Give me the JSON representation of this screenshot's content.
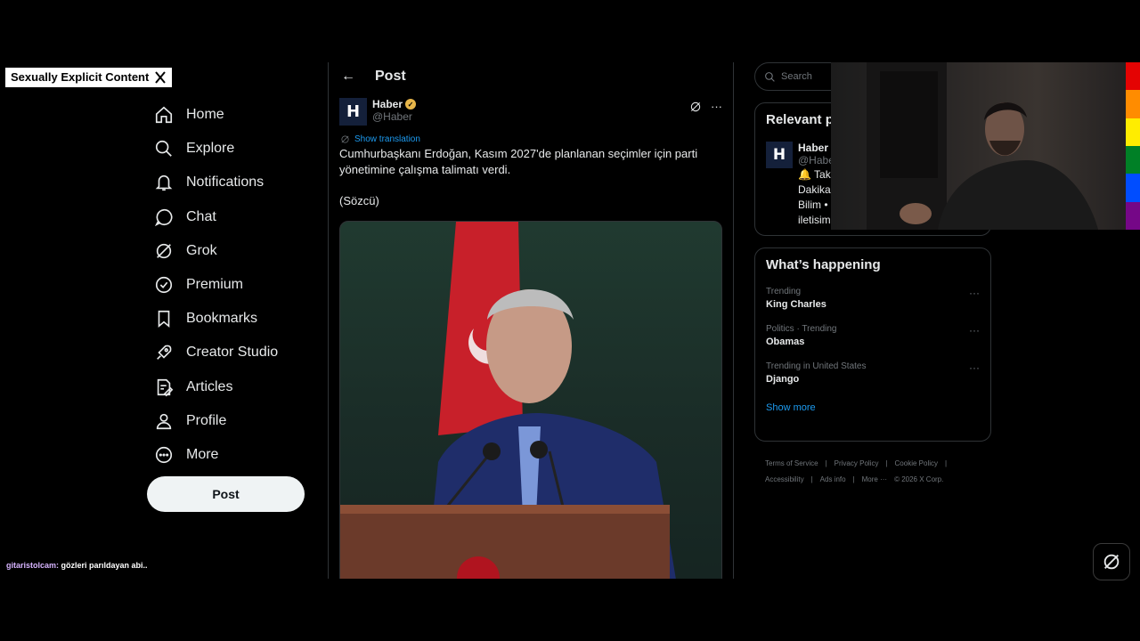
{
  "overlay": {
    "banner_text": "Sexually Explicit Content",
    "chat_user": "gitaristolcam:",
    "chat_message": " gözleri parıldayan abi.."
  },
  "nav": {
    "items": [
      {
        "label": "Home",
        "icon": "home-icon"
      },
      {
        "label": "Explore",
        "icon": "search-icon"
      },
      {
        "label": "Notifications",
        "icon": "bell-icon"
      },
      {
        "label": "Chat",
        "icon": "chat-icon"
      },
      {
        "label": "Grok",
        "icon": "grok-icon"
      },
      {
        "label": "Premium",
        "icon": "premium-icon"
      },
      {
        "label": "Bookmarks",
        "icon": "bookmark-icon"
      },
      {
        "label": "Creator Studio",
        "icon": "rocket-icon"
      },
      {
        "label": "Articles",
        "icon": "article-icon"
      },
      {
        "label": "Profile",
        "icon": "profile-icon"
      },
      {
        "label": "More",
        "icon": "more-circle-icon"
      }
    ],
    "post_button": "Post"
  },
  "center": {
    "back_arrow": "←",
    "title": "Post",
    "post": {
      "avatar_letter": "H",
      "author_name": "Haber",
      "author_handle": "@Haber",
      "more": "···",
      "show_translation": "Show translation",
      "text": "Cumhurbaşkanı Erdoğan, Kasım 2027'de planlanan seçimler için parti yönetimine çalışma talimatı verdi.",
      "source": "(Sözcü)"
    }
  },
  "right": {
    "search_placeholder": "Search",
    "relevant": {
      "title": "Relevant p",
      "user_name": "Haber",
      "user_handle": "@Habe",
      "bio_line1": "🔔 Tak",
      "bio_line2": "Dakika",
      "bio_line3": "Bilim • S",
      "bio_line4": "iletisim"
    },
    "happening": {
      "title": "What’s happening",
      "trends": [
        {
          "meta": "Trending",
          "topic": "King Charles"
        },
        {
          "meta": "Politics · Trending",
          "topic": "Obamas"
        },
        {
          "meta": "Trending in United States",
          "topic": "Django"
        }
      ],
      "show_more": "Show more"
    },
    "footer": {
      "links": [
        "Terms of Service",
        "|",
        "Privacy Policy",
        "|",
        "Cookie Policy",
        "|",
        "Accessibility",
        "|",
        "Ads info",
        "|",
        "More ···",
        "© 2026 X Corp."
      ]
    }
  },
  "colors": {
    "background": "#000000",
    "accent": "#1d9bf0",
    "text": "#e7e9ea",
    "muted": "#71767b",
    "border": "#2f3336",
    "rainbow": [
      "#e40303",
      "#ff8c00",
      "#ffed00",
      "#008026",
      "#004dff",
      "#750787"
    ]
  }
}
